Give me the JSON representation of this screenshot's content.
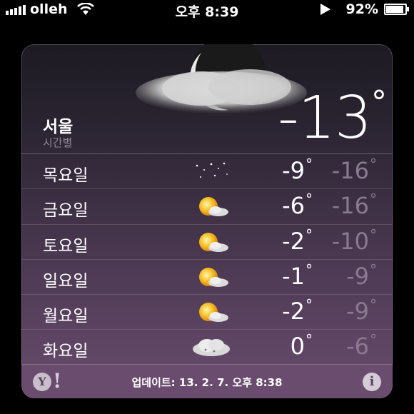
{
  "status_bar": {
    "carrier": "olleh",
    "time": "오후 8:39",
    "battery_percent": "92%",
    "battery_level": 0.92
  },
  "weather": {
    "city": "서울",
    "subtitle": "시간별",
    "current_temp": "-13",
    "current_deg": "°",
    "current_icon": "moon-cloud-icon",
    "forecast": [
      {
        "day": "목요일",
        "icon": "night-stars-icon",
        "high": "-9",
        "low": "-16"
      },
      {
        "day": "금요일",
        "icon": "sun-cloud-icon",
        "high": "-6",
        "low": "-16"
      },
      {
        "day": "토요일",
        "icon": "sun-cloud-icon",
        "high": "-2",
        "low": "-10"
      },
      {
        "day": "일요일",
        "icon": "sun-cloud-icon",
        "high": "-1",
        "low": "-9"
      },
      {
        "day": "월요일",
        "icon": "sun-cloud-icon",
        "high": "-2",
        "low": "-9"
      },
      {
        "day": "화요일",
        "icon": "snow-cloud-icon",
        "high": "0",
        "low": "-6"
      }
    ],
    "deg_symbol": "°"
  },
  "footer": {
    "yahoo_letter": "Y",
    "yahoo_bang": "!",
    "updated_text": "업데이트: 13. 2. 7. 오후 8:38",
    "info_symbol": "i"
  }
}
